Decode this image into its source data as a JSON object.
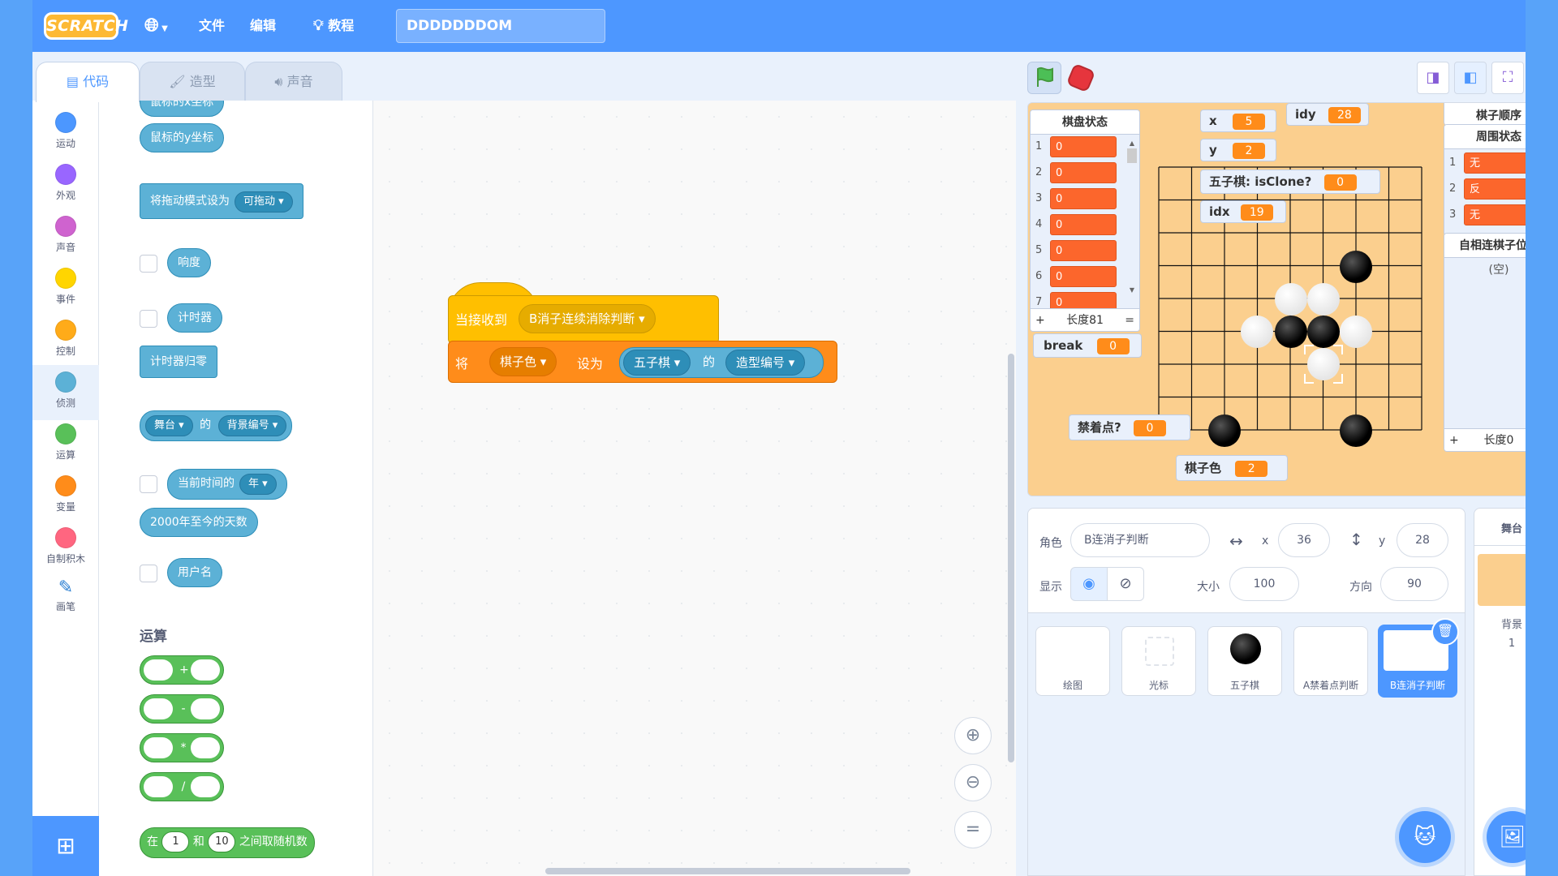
{
  "menubar": {
    "logo": "SCRATCH",
    "file": "文件",
    "edit": "编辑",
    "tutorials": "教程",
    "project_title": "DDDDDDDOM"
  },
  "tabs": {
    "code": "代码",
    "costumes": "造型",
    "sounds": "声音"
  },
  "categories": [
    {
      "label": "运动",
      "color": "#4c97ff"
    },
    {
      "label": "外观",
      "color": "#9966ff"
    },
    {
      "label": "声音",
      "color": "#cf63cf"
    },
    {
      "label": "事件",
      "color": "#ffd500"
    },
    {
      "label": "控制",
      "color": "#ffab19"
    },
    {
      "label": "侦测",
      "color": "#5cb1d6"
    },
    {
      "label": "运算",
      "color": "#59c059"
    },
    {
      "label": "变量",
      "color": "#ff8c1a"
    },
    {
      "label": "自制积木",
      "color": "#ff6680"
    },
    {
      "label": "画笔",
      "color": "#0fbd8c"
    }
  ],
  "palette": {
    "mouse_x": "鼠标的x坐标",
    "mouse_y": "鼠标的y坐标",
    "drag_mode": "将拖动模式设为",
    "drag_mode_value": "可拖动",
    "loudness": "响度",
    "timer": "计时器",
    "reset_timer": "计时器归零",
    "stage": "舞台",
    "of": "的",
    "backdrop_no": "背景编号",
    "current": "当前时间的",
    "year": "年",
    "days_since": "2000年至今的天数",
    "username": "用户名",
    "operators_header": "运算",
    "ops": [
      "+",
      "-",
      "*",
      "/"
    ],
    "random_pre": "在",
    "random_a": "1",
    "random_and": "和",
    "random_b": "10",
    "random_post": "之间取随机数"
  },
  "script": {
    "hat_label": "当接收到",
    "hat_msg": "B消子连续消除判断",
    "set_label": "将",
    "var_name": "棋子色",
    "set_to": "设为",
    "sprite_name": "五子棋",
    "of": "的",
    "costume_no": "造型编号"
  },
  "stage": {
    "board_list": {
      "title": "棋盘状态",
      "items": [
        {
          "i": "1",
          "v": "0"
        },
        {
          "i": "2",
          "v": "0"
        },
        {
          "i": "3",
          "v": "0"
        },
        {
          "i": "4",
          "v": "0"
        },
        {
          "i": "5",
          "v": "0"
        },
        {
          "i": "6",
          "v": "0"
        },
        {
          "i": "7",
          "v": "0"
        }
      ],
      "plus": "+",
      "length": "长度81",
      "eq": "="
    },
    "var_x": {
      "label": "x",
      "value": "5"
    },
    "var_y": {
      "label": "y",
      "value": "2"
    },
    "var_idy": {
      "label": "idy",
      "value": "28"
    },
    "var_isclone": {
      "label": "五子棋: isClone?",
      "value": "0"
    },
    "var_idx": {
      "label": "idx",
      "value": "19"
    },
    "var_break": {
      "label": "break",
      "value": "0"
    },
    "var_forbidden": {
      "label": "禁着点?",
      "value": "0"
    },
    "var_color": {
      "label": "棋子色",
      "value": "2"
    },
    "order_list": {
      "title": "棋子顺序"
    },
    "around_list": {
      "title": "周围状态",
      "items": [
        {
          "i": "1",
          "v": "无"
        },
        {
          "i": "2",
          "v": "反"
        },
        {
          "i": "3",
          "v": "无"
        }
      ]
    },
    "connect_list": {
      "title": "自相连棋子位置",
      "empty": "(空)",
      "plus": "+",
      "length": "长度0",
      "eq": "="
    }
  },
  "sprite_info": {
    "sprite_label": "角色",
    "sprite_name": "B连消子判断",
    "x_label": "x",
    "x": "36",
    "y_label": "y",
    "y": "28",
    "show_label": "显示",
    "size_label": "大小",
    "size": "100",
    "dir_label": "方向",
    "direction": "90"
  },
  "sprites": [
    {
      "name": "绘图"
    },
    {
      "name": "光标"
    },
    {
      "name": "五子棋"
    },
    {
      "name": "A禁着点判断"
    },
    {
      "name": "B连消子判断"
    }
  ],
  "stage_pane": {
    "title": "舞台",
    "backdrops_label": "背景",
    "backdrops_count": "1"
  },
  "colors": {
    "menubar": "#4d97ff",
    "stage_bg": "#fbcf8e",
    "list_item": "#fc662c",
    "variable": "#ff8c1a",
    "sensing": "#5cb1d6",
    "operators": "#59c059",
    "events": "#ffbf00"
  }
}
